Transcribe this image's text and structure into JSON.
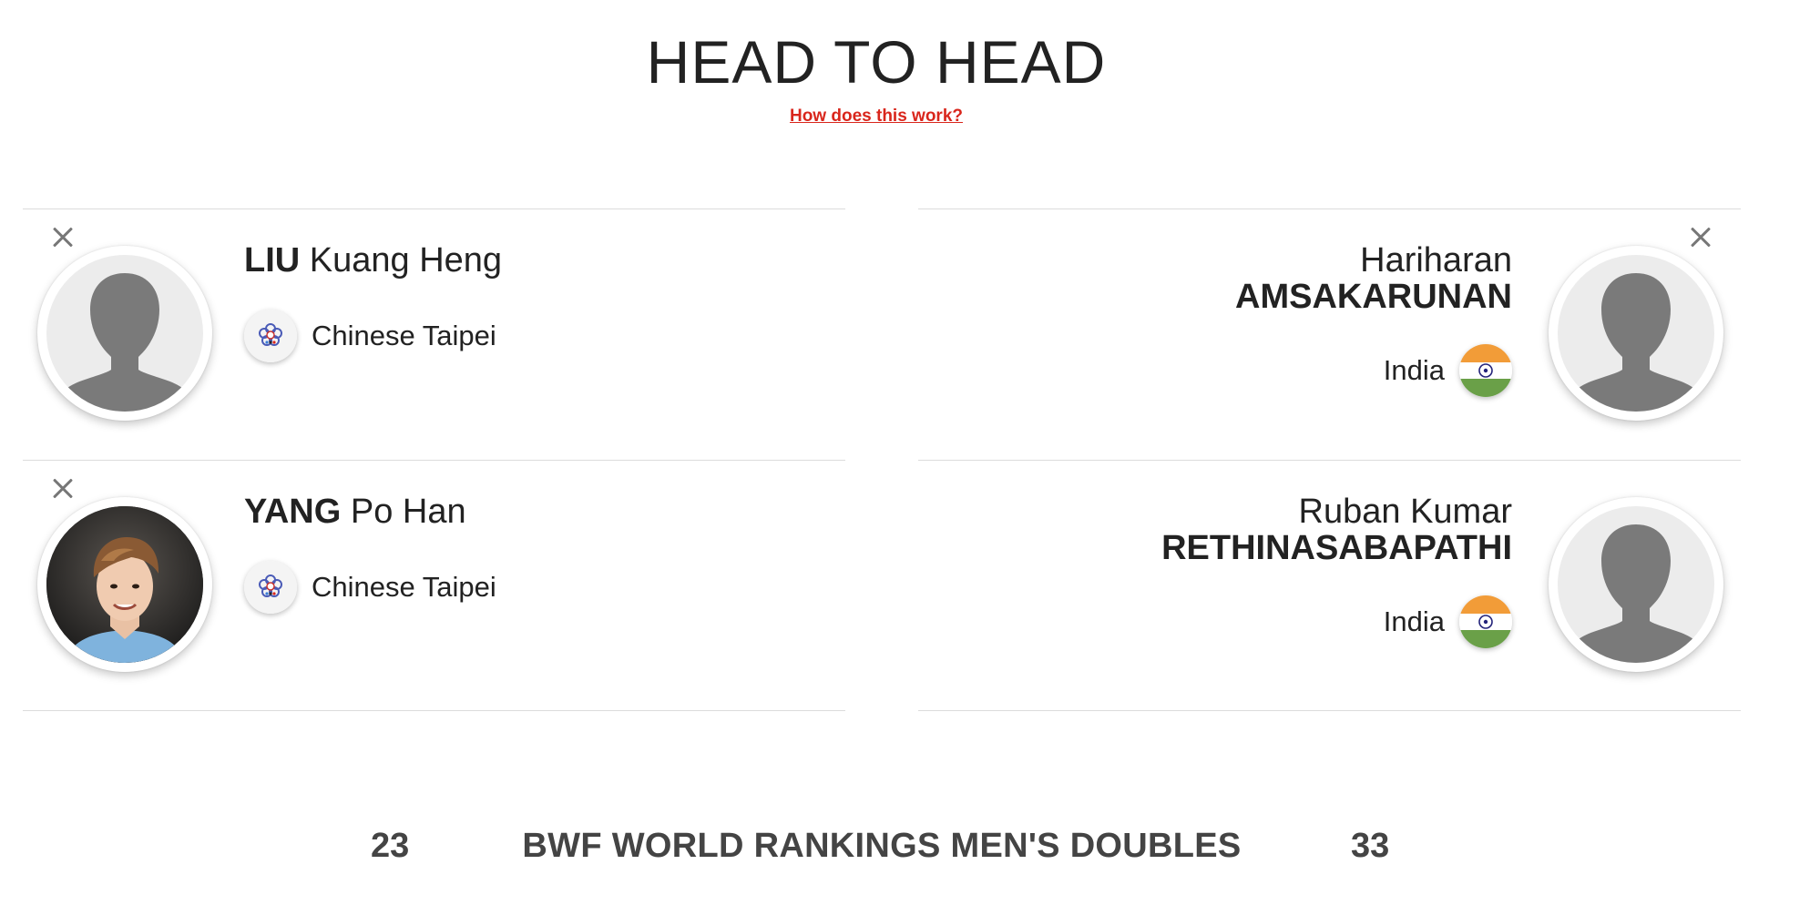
{
  "page": {
    "title": "HEAD TO HEAD",
    "help_link": "How does this work?"
  },
  "team_left": {
    "players": [
      {
        "surname": "LIU",
        "given": "Kuang Heng",
        "country": "Chinese Taipei",
        "flag_icon": "chinese-taipei-flag-icon",
        "photo": "placeholder"
      },
      {
        "surname": "YANG",
        "given": "Po Han",
        "country": "Chinese Taipei",
        "flag_icon": "chinese-taipei-flag-icon",
        "photo": "portrait"
      }
    ]
  },
  "team_right": {
    "players": [
      {
        "given": "Hariharan",
        "surname": "AMSAKARUNAN",
        "country": "India",
        "flag_icon": "india-flag-icon",
        "photo": "placeholder"
      },
      {
        "given": "Ruban Kumar",
        "surname": "RETHINASABAPATHI",
        "country": "India",
        "flag_icon": "india-flag-icon",
        "photo": "placeholder"
      }
    ]
  },
  "ranking": {
    "title": "BWF WORLD RANKINGS MEN'S DOUBLES",
    "left_value": "23",
    "right_value": "33"
  },
  "colors": {
    "accent_link": "#d9261c",
    "divider": "#dcdcdc",
    "text": "#222222",
    "placeholder_silhouette": "#7a7a7a"
  },
  "icons": {
    "remove": "close-icon",
    "avatar_placeholder": "person-silhouette-icon"
  }
}
